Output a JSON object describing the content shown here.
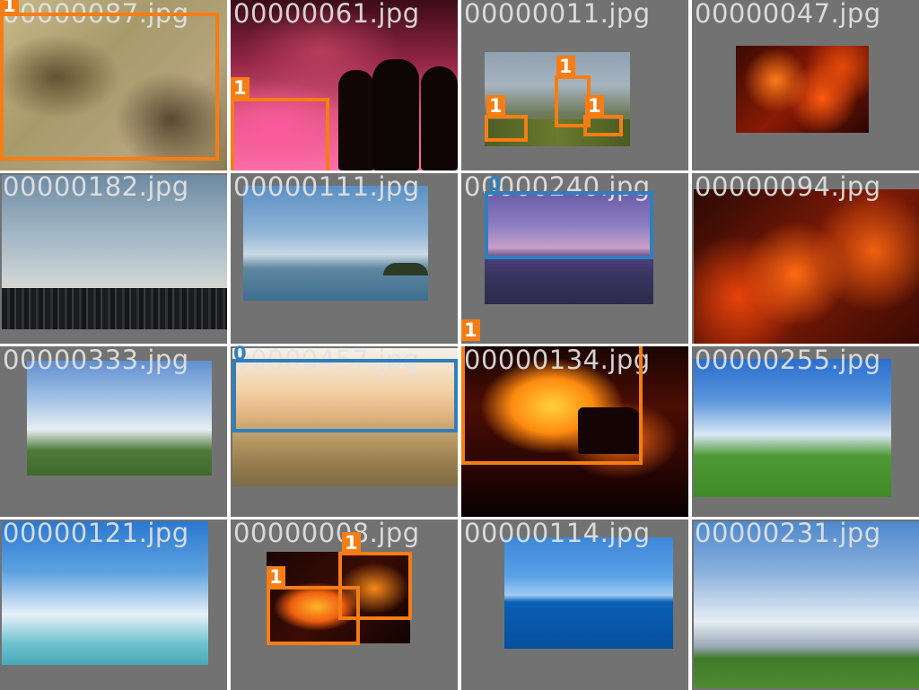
{
  "colors": {
    "class_1_box": "#f57d14",
    "class_0_box": "#2f7fbf",
    "tile_background": "#727272"
  },
  "tiles": [
    {
      "filename": "00000087.jpg",
      "boxes": [
        {
          "cls": "1",
          "label": "1"
        }
      ]
    },
    {
      "filename": "00000061.jpg",
      "boxes": [
        {
          "cls": "1",
          "label": "1"
        }
      ]
    },
    {
      "filename": "00000011.jpg",
      "boxes": [
        {
          "cls": "1",
          "label": "1"
        },
        {
          "cls": "1",
          "label": "1"
        },
        {
          "cls": "1",
          "label": "1"
        }
      ]
    },
    {
      "filename": "00000047.jpg",
      "boxes": []
    },
    {
      "filename": "00000182.jpg",
      "boxes": []
    },
    {
      "filename": "00000111.jpg",
      "boxes": []
    },
    {
      "filename": "00000240.jpg",
      "boxes": [
        {
          "cls": "0",
          "label": "0"
        }
      ]
    },
    {
      "filename": "00000094.jpg",
      "boxes": []
    },
    {
      "filename": "00000333.jpg",
      "boxes": []
    },
    {
      "filename": "00000457.jpg",
      "boxes": [
        {
          "cls": "0",
          "label": "0"
        }
      ]
    },
    {
      "filename": "00000134.jpg",
      "boxes": [
        {
          "cls": "1",
          "label": "1"
        }
      ]
    },
    {
      "filename": "00000255.jpg",
      "boxes": []
    },
    {
      "filename": "00000121.jpg",
      "boxes": []
    },
    {
      "filename": "00000008.jpg",
      "boxes": [
        {
          "cls": "1",
          "label": "1"
        },
        {
          "cls": "1",
          "label": "1"
        }
      ]
    },
    {
      "filename": "00000114.jpg",
      "boxes": []
    },
    {
      "filename": "00000231.jpg",
      "boxes": []
    }
  ]
}
